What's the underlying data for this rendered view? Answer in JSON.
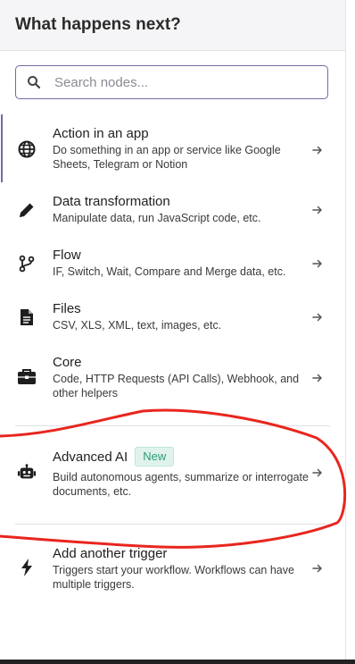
{
  "panel": {
    "title": "What happens next?",
    "search": {
      "placeholder": "Search nodes..."
    }
  },
  "items": [
    {
      "icon": "globe-icon",
      "title": "Action in an app",
      "desc": "Do something in an app or service like Google Sheets, Telegram or Notion"
    },
    {
      "icon": "pencil-icon",
      "title": "Data transformation",
      "desc": "Manipulate data, run JavaScript code, etc."
    },
    {
      "icon": "branch-icon",
      "title": "Flow",
      "desc": "IF, Switch, Wait, Compare and Merge data, etc."
    },
    {
      "icon": "file-icon",
      "title": "Files",
      "desc": "CSV, XLS, XML, text, images, etc."
    },
    {
      "icon": "toolbox-icon",
      "title": "Core",
      "desc": "Code, HTTP Requests (API Calls), Webhook, and other helpers"
    },
    {
      "icon": "robot-icon",
      "title": "Advanced AI",
      "badge": "New",
      "desc": "Build autonomous agents, summarize or interrogate documents, etc."
    },
    {
      "icon": "bolt-icon",
      "title": "Add another trigger",
      "desc": "Triggers start your workflow. Workflows can have multiple triggers."
    }
  ],
  "colors": {
    "accent": "#6f6ba8",
    "badge_bg": "#dff3ec",
    "badge_text": "#2e9b72",
    "annotation": "#e8261e"
  }
}
